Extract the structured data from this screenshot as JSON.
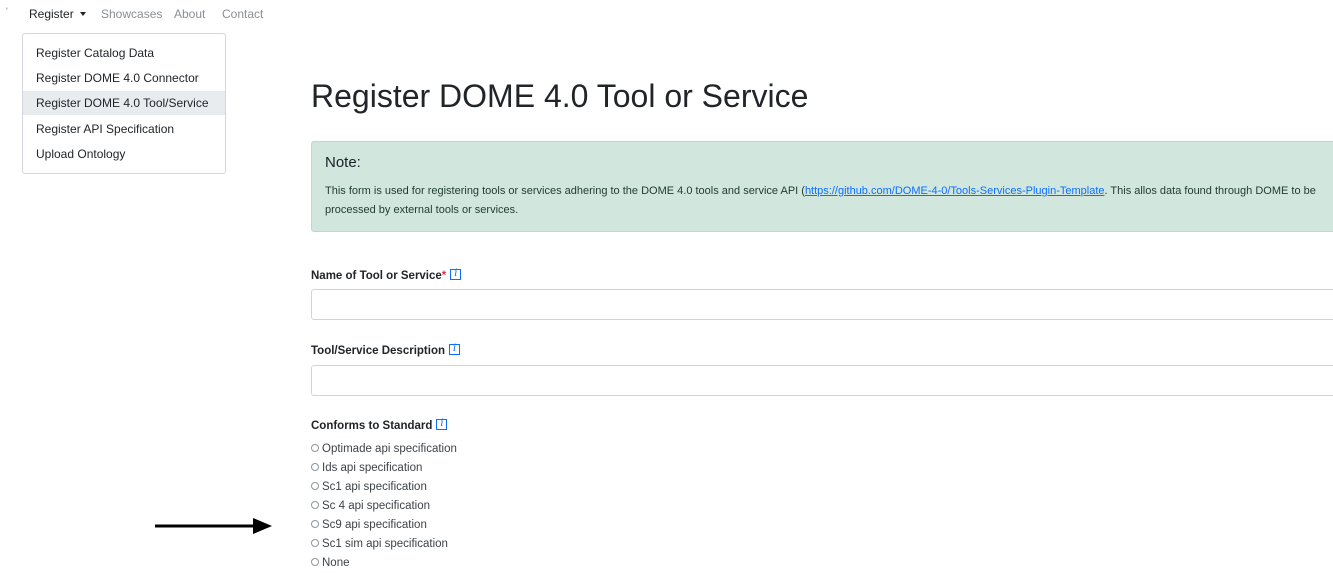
{
  "nav": {
    "register_label": "Register",
    "showcases_label": "Showcases",
    "about_label": "About",
    "contact_label": "Contact"
  },
  "dropdown": {
    "items": [
      {
        "label": "Register Catalog Data"
      },
      {
        "label": "Register DOME 4.0 Connector"
      },
      {
        "label": "Register DOME 4.0 Tool/Service",
        "selected": true
      },
      {
        "label": "Register API Specification"
      },
      {
        "label": "Upload Ontology"
      }
    ]
  },
  "page": {
    "title": "Register DOME 4.0 Tool or Service"
  },
  "note": {
    "title": "Note:",
    "text_before": "This form is used for registering tools or services adhering to the DOME 4.0 tools and service API (",
    "link_text": "https://github.com/DOME-4-0/Tools-Services-Plugin-Template",
    "text_after": ". This allos data found through DOME to be processed by external tools or services."
  },
  "form": {
    "name_label": "Name of Tool or Service",
    "required_mark": "*",
    "name_value": "",
    "description_label": "Tool/Service Description",
    "description_value": "",
    "standard_label": "Conforms to Standard",
    "standard_options": [
      "Optimade api specification",
      "Ids api specification",
      "Sc1 api specification",
      "Sc 4 api specification",
      "Sc9 api specification",
      "Sc1 sim api specification",
      "None"
    ]
  },
  "icons": {
    "info": "info-icon",
    "annotation_arrow": "arrow-right-icon"
  },
  "colors": {
    "note_background": "#d1e7dd",
    "link": "#0d6efd",
    "required": "#dc3545",
    "selected_item": "#e9ecef"
  }
}
